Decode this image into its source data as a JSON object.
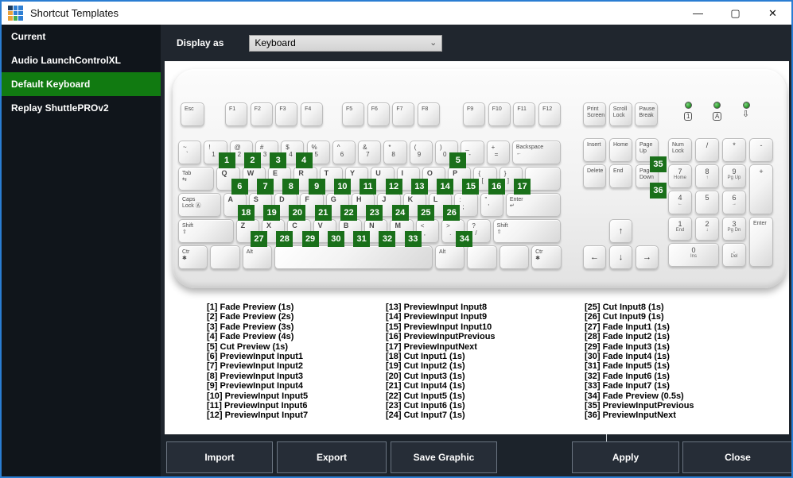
{
  "window": {
    "title": "Shortcut Templates",
    "controls": {
      "minimize": "—",
      "maximize": "▢",
      "close": "✕"
    },
    "icon_grid": [
      "#1c3c5e",
      "#2f7fd3",
      "#2f7fd3",
      "#e9a23b",
      "#2f7fd3",
      "#2f7fd3",
      "#e9a23b",
      "#43ad4d",
      "#2f7fd3"
    ]
  },
  "sidebar": {
    "items": [
      {
        "label": "Current",
        "selected": false
      },
      {
        "label": "Audio LaunchControlXL",
        "selected": false
      },
      {
        "label": "Default Keyboard",
        "selected": true
      },
      {
        "label": "Replay ShuttlePROv2",
        "selected": false
      }
    ]
  },
  "topbar": {
    "display_as_label": "Display as",
    "dropdown_value": "Keyboard",
    "chevron": "⌄"
  },
  "keyboard": {
    "esc": {
      "t": "Esc",
      "s": "word"
    },
    "f_keys": [
      "F1",
      "F2",
      "F3",
      "F4",
      "F5",
      "F6",
      "F7",
      "F8",
      "F9",
      "F10",
      "F11",
      "F12"
    ],
    "system_keys": [
      {
        "t": "Print",
        "b": "Screen",
        "s": "word"
      },
      {
        "t": "Scroll",
        "b": "Lock",
        "s": "word"
      },
      {
        "t": "Pause",
        "b": "Break",
        "s": "word"
      }
    ],
    "leds": [
      {
        "box": "1"
      },
      {
        "box": "A"
      },
      {
        "arrow": "⇩"
      }
    ],
    "main_rows": [
      [
        {
          "t": "~",
          "b": "`",
          "s": "sym"
        },
        {
          "t": "!",
          "b": "1",
          "s": "sym",
          "badge": 1
        },
        {
          "t": "@",
          "b": "2",
          "s": "sym",
          "badge": 2
        },
        {
          "t": "#",
          "b": "3",
          "s": "sym",
          "badge": 3
        },
        {
          "t": "$",
          "b": "4",
          "s": "sym",
          "badge": 4
        },
        {
          "t": "%",
          "b": "5",
          "s": "sym"
        },
        {
          "t": "^",
          "b": "6",
          "s": "sym"
        },
        {
          "t": "&",
          "b": "7",
          "s": "sym"
        },
        {
          "t": "*",
          "b": "8",
          "s": "sym"
        },
        {
          "t": "(",
          "b": "9",
          "s": "sym"
        },
        {
          "t": ")",
          "b": "0",
          "s": "sym",
          "badge": 5
        },
        {
          "t": "_",
          "b": "-",
          "s": "sym"
        },
        {
          "t": "+",
          "b": "=",
          "s": "sym"
        },
        {
          "t": "Backspace",
          "b": "←",
          "s": "word",
          "w": 2
        }
      ],
      [
        {
          "t": "Tab",
          "b": "⇆",
          "s": "word",
          "w": 1.5
        },
        {
          "t": "Q",
          "s": "letter",
          "badge": 6
        },
        {
          "t": "W",
          "s": "letter",
          "badge": 7
        },
        {
          "t": "E",
          "s": "letter",
          "badge": 8
        },
        {
          "t": "R",
          "s": "letter",
          "badge": 9
        },
        {
          "t": "T",
          "s": "letter",
          "badge": 10
        },
        {
          "t": "Y",
          "s": "letter",
          "badge": 11
        },
        {
          "t": "U",
          "s": "letter",
          "badge": 12
        },
        {
          "t": "I",
          "s": "letter",
          "badge": 13
        },
        {
          "t": "O",
          "s": "letter",
          "badge": 14
        },
        {
          "t": "P",
          "s": "letter",
          "badge": 15
        },
        {
          "t": "{",
          "b": "[",
          "s": "sym",
          "badge": 16
        },
        {
          "t": "}",
          "b": "]",
          "s": "sym",
          "badge": 17
        },
        {
          "s": "blank",
          "w": 1.5
        }
      ],
      [
        {
          "t": "Caps",
          "b": "Lock Ⓐ",
          "s": "word",
          "w": 1.75
        },
        {
          "t": "A",
          "s": "letter",
          "badge": 18
        },
        {
          "t": "S",
          "s": "letter",
          "badge": 19
        },
        {
          "t": "D",
          "s": "letter",
          "badge": 20
        },
        {
          "t": "F",
          "s": "letter",
          "badge": 21
        },
        {
          "t": "G",
          "s": "letter",
          "badge": 22
        },
        {
          "t": "H",
          "s": "letter",
          "badge": 23
        },
        {
          "t": "J",
          "s": "letter",
          "badge": 24
        },
        {
          "t": "K",
          "s": "letter",
          "badge": 25
        },
        {
          "t": "L",
          "s": "letter",
          "badge": 26
        },
        {
          "t": ":",
          "b": ";",
          "s": "sym"
        },
        {
          "t": "\"",
          "b": "'",
          "s": "sym"
        },
        {
          "t": "Enter",
          "b": "↵",
          "s": "word",
          "w": 2.25
        }
      ],
      [
        {
          "t": "Shift",
          "b": "⇧",
          "s": "word",
          "w": 2.25
        },
        {
          "t": "Z",
          "s": "letter",
          "badge": 27
        },
        {
          "t": "X",
          "s": "letter",
          "badge": 28
        },
        {
          "t": "C",
          "s": "letter",
          "badge": 29
        },
        {
          "t": "V",
          "s": "letter",
          "badge": 30
        },
        {
          "t": "B",
          "s": "letter",
          "badge": 31
        },
        {
          "t": "N",
          "s": "letter",
          "badge": 32
        },
        {
          "t": "M",
          "s": "letter",
          "badge": 33
        },
        {
          "t": "<",
          "b": ",",
          "s": "sym"
        },
        {
          "t": ">",
          "b": ".",
          "s": "sym",
          "badge": 34
        },
        {
          "t": "?",
          "b": "/",
          "s": "sym"
        },
        {
          "t": "Shift",
          "b": "⇧",
          "s": "word",
          "w": 2.75
        }
      ],
      [
        {
          "t": "Ctr",
          "b": "✱",
          "s": "word",
          "w": 1.25
        },
        {
          "s": "blank",
          "w": 1.25
        },
        {
          "t": "Alt",
          "s": "word",
          "w": 1.25
        },
        {
          "s": "blank",
          "w": 6.25
        },
        {
          "t": "Alt",
          "s": "word",
          "w": 1.25
        },
        {
          "s": "blank",
          "w": 1.25
        },
        {
          "s": "blank",
          "w": 1.25
        },
        {
          "t": "Ctr",
          "b": "✱",
          "s": "word",
          "w": 1.25
        }
      ]
    ],
    "nav_rows": [
      [
        {
          "t": "Insert",
          "s": "word"
        },
        {
          "t": "Home",
          "s": "word"
        },
        {
          "t": "Page",
          "b": "Up",
          "s": "word",
          "badge": 35
        }
      ],
      [
        {
          "t": "Delete",
          "s": "word"
        },
        {
          "t": "End",
          "s": "word"
        },
        {
          "t": "Page",
          "b": "Down",
          "s": "word",
          "badge": 36
        }
      ]
    ],
    "arrows": {
      "up": "↑",
      "left": "←",
      "down": "↓",
      "right": "→"
    },
    "numpad_rows": [
      [
        {
          "t": "Num",
          "b": "Lock",
          "s": "word"
        },
        {
          "t": "/",
          "s": "np"
        },
        {
          "t": "*",
          "s": "np"
        },
        {
          "t": "-",
          "s": "np"
        }
      ],
      [
        {
          "t": "7",
          "b": "Home",
          "s": "np"
        },
        {
          "t": "8",
          "b": "↑",
          "s": "np"
        },
        {
          "t": "9",
          "b": "Pg Up",
          "s": "np"
        },
        {
          "t": "+",
          "s": "np",
          "h": 2
        }
      ],
      [
        {
          "t": "4",
          "b": "←",
          "s": "np"
        },
        {
          "t": "5",
          "s": "np"
        },
        {
          "t": "6",
          "b": "→",
          "s": "np"
        }
      ],
      [
        {
          "t": "1",
          "b": "End",
          "s": "np"
        },
        {
          "t": "2",
          "b": "↓",
          "s": "np"
        },
        {
          "t": "3",
          "b": "Pg Dn",
          "s": "np"
        },
        {
          "t": "Enter",
          "s": "word",
          "h": 2
        }
      ],
      [
        {
          "t": "0",
          "b": "Ins",
          "s": "np",
          "w": 2
        },
        {
          "t": ".",
          "b": "Del",
          "s": "np"
        }
      ]
    ]
  },
  "shortcuts": {
    "columns": [
      [
        "[1] Fade Preview (1s)",
        "[2] Fade Preview (2s)",
        "[3] Fade Preview (3s)",
        "[4] Fade Preview (4s)",
        "[5] Cut Preview (1s)",
        "[6] PreviewInput Input1",
        "[7] PreviewInput Input2",
        "[8] PreviewInput Input3",
        "[9] PreviewInput Input4",
        "[10] PreviewInput Input5",
        "[11] PreviewInput Input6",
        "[12] PreviewInput Input7"
      ],
      [
        "[13] PreviewInput Input8",
        "[14] PreviewInput Input9",
        "[15] PreviewInput Input10",
        "[16] PreviewInputPrevious",
        "[17] PreviewInputNext",
        "[18] Cut Input1 (1s)",
        "[19] Cut Input2 (1s)",
        "[20] Cut Input3 (1s)",
        "[21] Cut Input4 (1s)",
        "[22] Cut Input5 (1s)",
        "[23] Cut Input6 (1s)",
        "[24] Cut Input7 (1s)"
      ],
      [
        "[25] Cut Input8 (1s)",
        "[26] Cut Input9 (1s)",
        "[27] Fade Input1 (1s)",
        "[28] Fade Input2 (1s)",
        "[29] Fade Input3 (1s)",
        "[30] Fade Input4 (1s)",
        "[31] Fade Input5 (1s)",
        "[32] Fade Input6 (1s)",
        "[33] Fade Input7 (1s)",
        "[34] Fade Preview (0.5s)",
        "[35] PreviewInputPrevious",
        "[36] PreviewInputNext"
      ]
    ]
  },
  "buttons": [
    "Import",
    "Export",
    "Save Graphic",
    "Apply",
    "Close"
  ],
  "colors": {
    "window_border": "#2a7dd2",
    "sidebar_bg": "#10151b",
    "selected_green": "#117a11",
    "badge_green": "#1a701a",
    "dark_bar": "#20262e",
    "button_bg": "#262d37"
  }
}
